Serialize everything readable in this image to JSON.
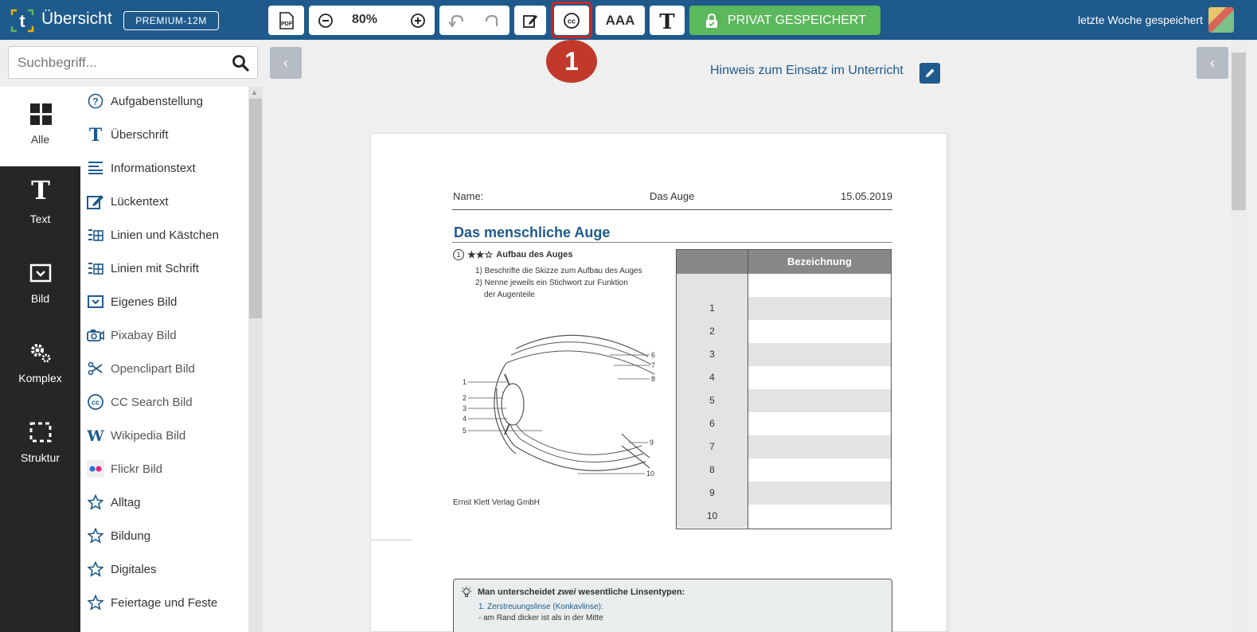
{
  "header": {
    "app_title": "Übersicht",
    "plan_badge": "PREMIUM-12M",
    "zoom_level": "80%",
    "text_size_label": "AAA",
    "privat_label": "PRIVAT GESPEICHERT",
    "saved_status": "letzte Woche gespeichert",
    "colors": {
      "bar": "#1e5a8c",
      "privat": "#5cb85c",
      "highlight": "#c62828"
    }
  },
  "annotation": {
    "marker": "1"
  },
  "sidebar": {
    "search_placeholder": "Suchbegriff...",
    "categories": [
      {
        "label": "Alle",
        "icon": "grid-icon"
      },
      {
        "label": "Text",
        "icon": "text-icon"
      },
      {
        "label": "Bild",
        "icon": "image-icon"
      },
      {
        "label": "Komplex",
        "icon": "gears-icon"
      },
      {
        "label": "Struktur",
        "icon": "frame-icon"
      }
    ],
    "items": [
      {
        "label": "Aufgabenstellung",
        "icon": "question-icon"
      },
      {
        "label": "Überschrift",
        "icon": "heading-icon"
      },
      {
        "label": "Informationstext",
        "icon": "paragraph-icon"
      },
      {
        "label": "Lückentext",
        "icon": "edit-box-icon"
      },
      {
        "label": "Linien und Kästchen",
        "icon": "lines-grid-icon"
      },
      {
        "label": "Linien mit Schrift",
        "icon": "lines-grid-icon"
      },
      {
        "label": "Eigenes Bild",
        "icon": "image-icon"
      },
      {
        "label": "Pixabay Bild",
        "icon": "camera-icon"
      },
      {
        "label": "Openclipart Bild",
        "icon": "scissors-icon"
      },
      {
        "label": "CC Search Bild",
        "icon": "cc-icon"
      },
      {
        "label": "Wikipedia Bild",
        "icon": "wikipedia-icon"
      },
      {
        "label": "Flickr Bild",
        "icon": "flickr-icon"
      },
      {
        "label": "Alltag",
        "icon": "star-icon"
      },
      {
        "label": "Bildung",
        "icon": "star-icon"
      },
      {
        "label": "Digitales",
        "icon": "star-icon"
      },
      {
        "label": "Feiertage und Feste",
        "icon": "star-icon"
      }
    ]
  },
  "main": {
    "hint_link": "Hinweis zum Einsatz im Unterricht"
  },
  "document": {
    "name_label": "Name:",
    "subject": "Das Auge",
    "date": "15.05.2019",
    "title": "Das menschliche Auge",
    "task_number": "1",
    "task_stars": "★★☆",
    "task_title": "Aufbau des Auges",
    "instructions": [
      "1) Beschrifte die Skizze zum Aufbau des Auges",
      "2) Nenne jeweils ein Stichwort zur Funktion",
      "der Augenteile"
    ],
    "credit": "Ernst Klett Verlag GmbH",
    "table_header": "Bezeichnung",
    "rows": [
      "",
      "1",
      "2",
      "3",
      "4",
      "5",
      "6",
      "7",
      "8",
      "9",
      "10"
    ],
    "eye_labels_left": [
      "1",
      "2",
      "3",
      "4",
      "5"
    ],
    "eye_labels_right": [
      "6",
      "7",
      "8",
      "9",
      "10"
    ],
    "info_title_pre": "Man unterscheidet ",
    "info_title_em": "zwei",
    "info_title_post": " wesentliche Linsentypen:",
    "info_line1": "1. Zerstreuungslinse (Konkavlinse):",
    "info_line2": "- am Rand dicker ist als in der Mitte"
  }
}
